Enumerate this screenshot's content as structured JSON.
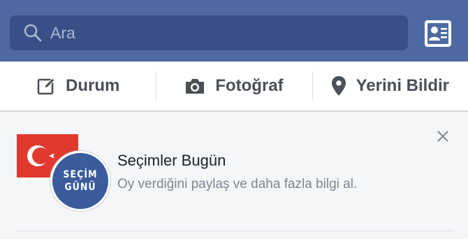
{
  "search": {
    "placeholder": "Ara",
    "icon": "search-icon"
  },
  "contact_button": {
    "icon": "contact-card-icon"
  },
  "composer": {
    "actions": [
      {
        "label": "Durum",
        "icon": "edit-icon"
      },
      {
        "label": "Fotoğraf",
        "icon": "camera-icon"
      },
      {
        "label": "Yerini Bildir",
        "icon": "location-pin-icon"
      }
    ]
  },
  "election_card": {
    "badge_text": [
      "SEÇİM",
      "GÜNÜ"
    ],
    "title": "Seçimler Bugün",
    "subtitle": "Oy verdiğini paylaş ve daha fazla bilgi al."
  },
  "colors": {
    "header": "#4e69a2",
    "search_field": "#3a4f85",
    "flag_red": "#e03a2f",
    "seal_blue": "#3a5b9c"
  }
}
